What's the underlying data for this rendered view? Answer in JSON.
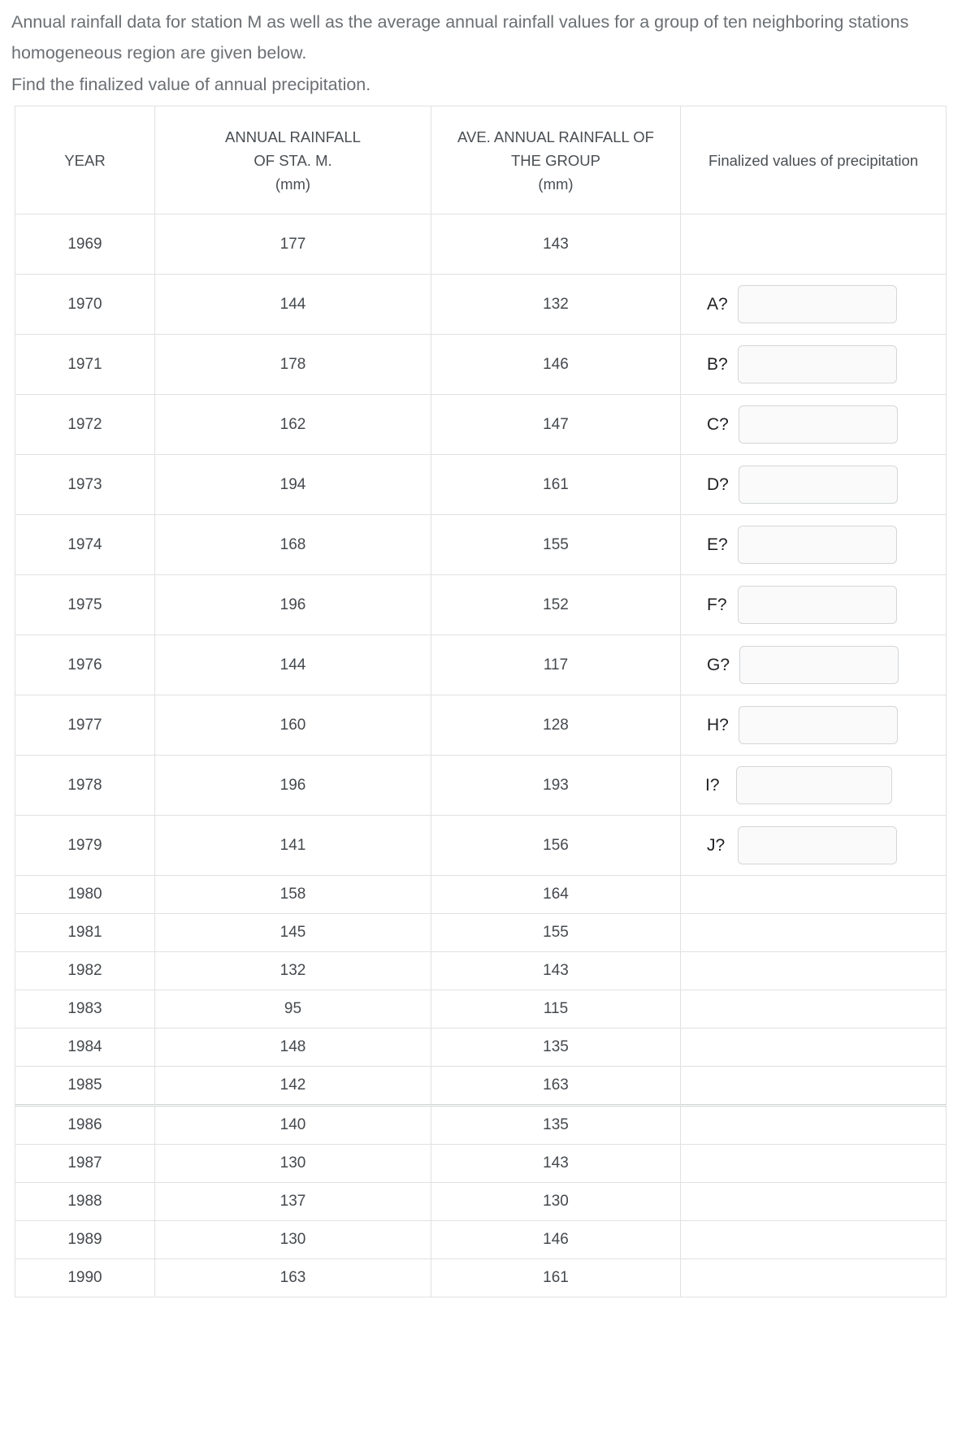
{
  "prompt": {
    "line1": "Annual rainfall data for station M as well as the average annual rainfall values for a group of ten neighboring stations",
    "line2": "homogeneous region are given below.",
    "line3": "Find the finalized value of annual precipitation."
  },
  "table": {
    "headers": {
      "year": "YEAR",
      "station_line1": "ANNUAL RAINFALL",
      "station_line2": "OF STA. M.",
      "station_line3": "(mm)",
      "group_line1": "AVE. ANNUAL RAINFALL OF",
      "group_line2": "THE GROUP",
      "group_line3": "(mm)",
      "finalized": "Finalized values of precipitation"
    },
    "rows": [
      {
        "year": "1969",
        "station": "177",
        "group": "143",
        "blank": "",
        "input": false,
        "size": "tall"
      },
      {
        "year": "1970",
        "station": "144",
        "group": "132",
        "blank": "A?",
        "input": true,
        "size": "tall"
      },
      {
        "year": "1971",
        "station": "178",
        "group": "146",
        "blank": "B?",
        "input": true,
        "size": "tall"
      },
      {
        "year": "1972",
        "station": "162",
        "group": "147",
        "blank": "C?",
        "input": true,
        "size": "tall"
      },
      {
        "year": "1973",
        "station": "194",
        "group": "161",
        "blank": "D?",
        "input": true,
        "size": "tall"
      },
      {
        "year": "1974",
        "station": "168",
        "group": "155",
        "blank": "E?",
        "input": true,
        "size": "tall"
      },
      {
        "year": "1975",
        "station": "196",
        "group": "152",
        "blank": "F?",
        "input": true,
        "size": "tall"
      },
      {
        "year": "1976",
        "station": "144",
        "group": "117",
        "blank": "G?",
        "input": true,
        "size": "tall"
      },
      {
        "year": "1977",
        "station": "160",
        "group": "128",
        "blank": "H?",
        "input": true,
        "size": "tall"
      },
      {
        "year": "1978",
        "station": "196",
        "group": "193",
        "blank": "I?",
        "input": true,
        "size": "tall"
      },
      {
        "year": "1979",
        "station": "141",
        "group": "156",
        "blank": "J?",
        "input": true,
        "size": "tall"
      },
      {
        "year": "1980",
        "station": "158",
        "group": "164",
        "blank": "",
        "input": false,
        "size": "short"
      },
      {
        "year": "1981",
        "station": "145",
        "group": "155",
        "blank": "",
        "input": false,
        "size": "short"
      },
      {
        "year": "1982",
        "station": "132",
        "group": "143",
        "blank": "",
        "input": false,
        "size": "short"
      },
      {
        "year": "1983",
        "station": "95",
        "group": "115",
        "blank": "",
        "input": false,
        "size": "short"
      },
      {
        "year": "1984",
        "station": "148",
        "group": "135",
        "blank": "",
        "input": false,
        "size": "short"
      },
      {
        "year": "1985",
        "station": "142",
        "group": "163",
        "blank": "",
        "input": false,
        "size": "short"
      },
      {
        "year": "1986",
        "station": "140",
        "group": "135",
        "blank": "",
        "input": false,
        "size": "short",
        "separator": true
      },
      {
        "year": "1987",
        "station": "130",
        "group": "143",
        "blank": "",
        "input": false,
        "size": "short"
      },
      {
        "year": "1988",
        "station": "137",
        "group": "130",
        "blank": "",
        "input": false,
        "size": "short"
      },
      {
        "year": "1989",
        "station": "130",
        "group": "146",
        "blank": "",
        "input": false,
        "size": "short"
      },
      {
        "year": "1990",
        "station": "163",
        "group": "161",
        "blank": "",
        "input": false,
        "size": "short"
      }
    ]
  },
  "input_placeholder": ""
}
